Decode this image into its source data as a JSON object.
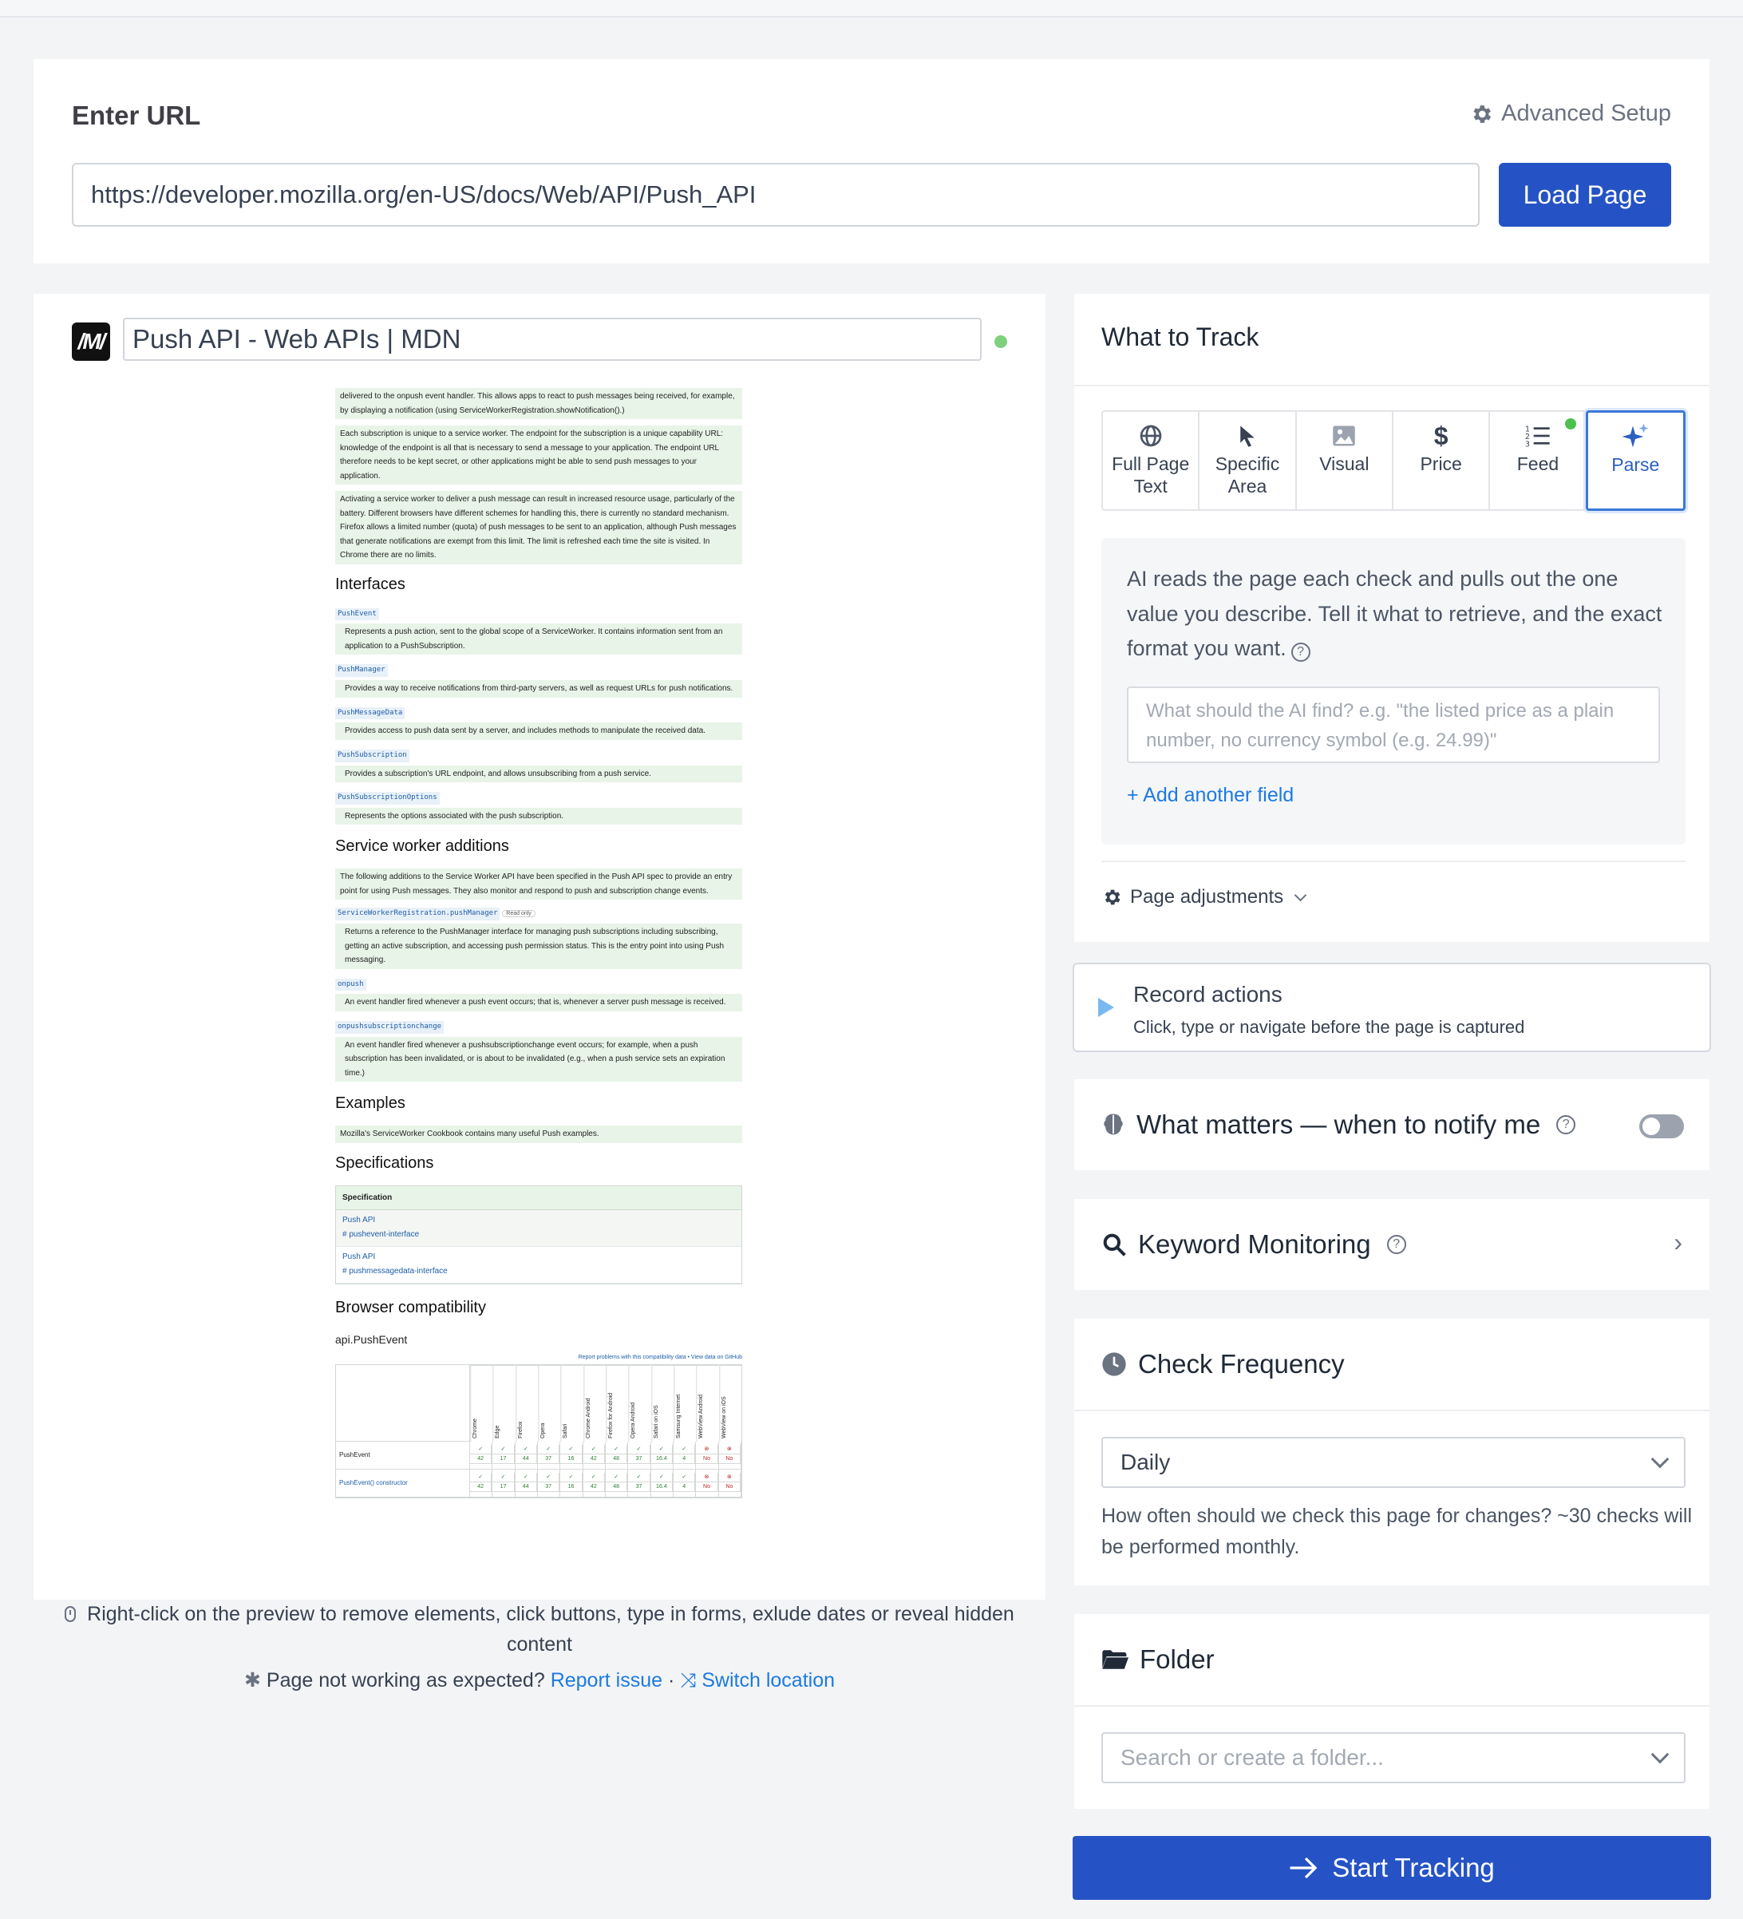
{
  "url_card": {
    "title": "Enter URL",
    "advanced_setup": "Advanced Setup",
    "url_value": "https://developer.mozilla.org/en-US/docs/Web/API/Push_API",
    "load_button": "Load Page"
  },
  "preview": {
    "logo_text": "/M/",
    "page_title": "Push API - Web APIs | MDN",
    "doc": {
      "p1": "delivered to the onpush event handler. This allows apps to react to push messages being received, for example, by displaying a notification (using ServiceWorkerRegistration.showNotification().)",
      "p2": "Each subscription is unique to a service worker. The endpoint for the subscription is a unique capability URL: knowledge of the endpoint is all that is necessary to send a message to your application. The endpoint URL therefore needs to be kept secret, or other applications might be able to send push messages to your application.",
      "p3": "Activating a service worker to deliver a push message can result in increased resource usage, particularly of the battery. Different browsers have different schemes for handling this, there is currently no standard mechanism. Firefox allows a limited number (quota) of push messages to be sent to an application, although Push messages that generate notifications are exempt from this limit. The limit is refreshed each time the site is visited. In Chrome there are no limits.",
      "h_interfaces": "Interfaces",
      "interfaces": [
        {
          "term": "PushEvent",
          "desc": "Represents a push action, sent to the global scope of a ServiceWorker. It contains information sent from an application to a PushSubscription."
        },
        {
          "term": "PushManager",
          "desc": "Provides a way to receive notifications from third-party servers, as well as request URLs for push notifications."
        },
        {
          "term": "PushMessageData",
          "desc": "Provides access to push data sent by a server, and includes methods to manipulate the received data."
        },
        {
          "term": "PushSubscription",
          "desc": "Provides a subscription's URL endpoint, and allows unsubscribing from a push service."
        },
        {
          "term": "PushSubscriptionOptions",
          "desc": "Represents the options associated with the push subscription."
        }
      ],
      "h_sw": "Service worker additions",
      "sw_intro": "The following additions to the Service Worker API have been specified in the Push API spec to provide an entry point for using Push messages. They also monitor and respond to push and subscription change events.",
      "sw_items": [
        {
          "term": "ServiceWorkerRegistration.pushManager",
          "badge": "Read only",
          "desc": "Returns a reference to the PushManager interface for managing push subscriptions including subscribing, getting an active subscription, and accessing push permission status. This is the entry point into using Push messaging."
        },
        {
          "term": "onpush",
          "badge": "",
          "desc": "An event handler fired whenever a push event occurs; that is, whenever a server push message is received."
        },
        {
          "term": "onpushsubscriptionchange",
          "badge": "",
          "desc": "An event handler fired whenever a pushsubscriptionchange event occurs; for example, when a push subscription has been invalidated, or is about to be invalidated (e.g., when a push service sets an expiration time.)"
        }
      ],
      "h_examples": "Examples",
      "examples_text": "Mozilla's ServiceWorker Cookbook contains many useful Push examples.",
      "h_specs": "Specifications",
      "spec_header": "Specification",
      "specs": [
        {
          "name": "Push API",
          "anchor": "# pushevent-interface"
        },
        {
          "name": "Push API",
          "anchor": "# pushmessagedata-interface"
        }
      ],
      "h_compat": "Browser compatibility",
      "compat_sub": "api.PushEvent",
      "compat_links": "Report problems with this compatibility data • View data on GitHub",
      "browsers": [
        "Chrome",
        "Edge",
        "Firefox",
        "Opera",
        "Safari",
        "Chrome Android",
        "Firefox for Android",
        "Opera Android",
        "Safari on iOS",
        "Samsung Internet",
        "WebView Android",
        "WebView on iOS"
      ],
      "rows": [
        {
          "name": "PushEvent",
          "cells": [
            "42",
            "17",
            "44",
            "37",
            "16",
            "42",
            "48",
            "37",
            "16.4",
            "4",
            "No",
            "No"
          ]
        },
        {
          "name": "PushEvent() constructor",
          "cells": [
            "42",
            "17",
            "44",
            "37",
            "16",
            "42",
            "48",
            "37",
            "16.4",
            "4",
            "No",
            "No"
          ]
        }
      ]
    },
    "footer_hint": "Right-click on the preview to remove elements, click buttons, type in forms, exlude dates or reveal hidden content",
    "footer_issue": "Page not working as expected?",
    "report_issue": "Report issue",
    "separator": "·",
    "switch_location": "Switch location"
  },
  "track": {
    "title": "What to Track",
    "modes": [
      {
        "label": "Full Page Text",
        "icon": "globe-icon"
      },
      {
        "label": "Specific Area",
        "icon": "cursor-icon"
      },
      {
        "label": "Visual",
        "icon": "image-icon"
      },
      {
        "label": "Price",
        "icon": "dollar-icon"
      },
      {
        "label": "Feed",
        "icon": "list-icon"
      },
      {
        "label": "Parse",
        "icon": "sparkle-icon"
      }
    ],
    "active_mode": "Parse",
    "parse_description": "AI reads the page each check and pulls out the one value you describe. Tell it what to retrieve, and the exact format you want.",
    "parse_placeholder": "What should the AI find? e.g. \"the listed price as a plain number, no currency symbol (e.g. 24.99)\"",
    "add_field": "+ Add another field",
    "page_adjustments": "Page adjustments"
  },
  "record": {
    "title": "Record actions",
    "subtitle": "Click, type or navigate before the page is captured"
  },
  "notify": {
    "title": "What matters — when to notify me",
    "enabled": false
  },
  "keyword": {
    "title": "Keyword Monitoring"
  },
  "frequency": {
    "title": "Check Frequency",
    "selected": "Daily",
    "help": "How often should we check this page for changes? ~30 checks will be performed monthly."
  },
  "folder": {
    "title": "Folder",
    "placeholder": "Search or create a folder..."
  },
  "start_button": "Start Tracking",
  "colors": {
    "primary": "#2553c5",
    "link": "#1d7ae0",
    "status_ok": "#7ed07e"
  }
}
